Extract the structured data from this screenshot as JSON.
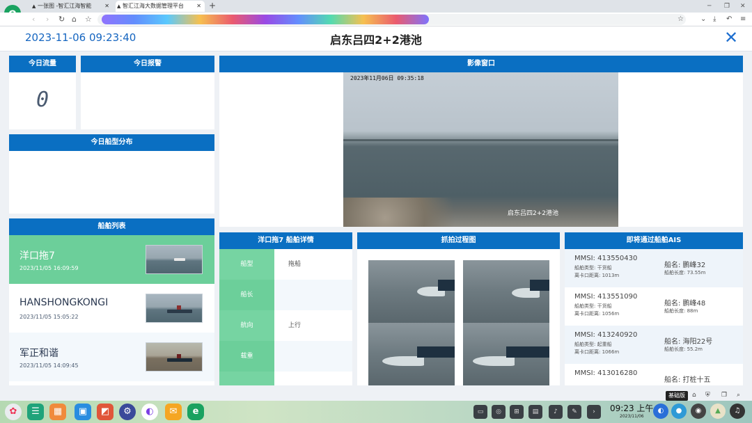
{
  "browser": {
    "tabs": [
      {
        "title": "一张图 -智汇江海智能"
      },
      {
        "title": "智汇江海大数据管理平台"
      }
    ],
    "logo_letter": "e"
  },
  "header": {
    "datetime": "2023-11-06 09:23:40",
    "title": "启东吕四2+2港池",
    "close_glyph": "✕"
  },
  "panels": {
    "today_flow": {
      "title": "今日流量",
      "value": "0"
    },
    "today_alarm": {
      "title": "今日报警"
    },
    "ship_type": {
      "title": "今日船型分布"
    },
    "ship_list": {
      "title": "船舶列表",
      "items": [
        {
          "name": "洋口拖7",
          "time": "2023/11/05 16:09:59"
        },
        {
          "name": "HANSHONGKONGI",
          "time": "2023/11/05 15:05:22"
        },
        {
          "name": "军正和谐",
          "time": "2023/11/05 14:09:45"
        }
      ]
    },
    "video": {
      "title": "影像窗口",
      "timestamp": "2023年11月06日  09:35:18",
      "caption": "启东吕四2+2港池"
    },
    "details": {
      "title": "洋口拖7 船舶详情",
      "rows": [
        {
          "label": "船型",
          "value": "拖船"
        },
        {
          "label": "船长",
          "value": ""
        },
        {
          "label": "航向",
          "value": "上行"
        },
        {
          "label": "载重",
          "value": ""
        }
      ]
    },
    "capture": {
      "title": "抓拍过程图"
    },
    "ais": {
      "title": "即将通过船舶AIS",
      "items": [
        {
          "mmsi": "MMSI:  413550430",
          "type": "船舶类型:  干货船",
          "dist": "离卡口距离:  1013m",
          "name": "船名:  鹏峰32",
          "length": "船舶长度:  73.55m"
        },
        {
          "mmsi": "MMSI:  413551090",
          "type": "船舶类型:  干货船",
          "dist": "离卡口距离:  1056m",
          "name": "船名:  鹏峰48",
          "length": "船舶长度:  88m"
        },
        {
          "mmsi": "MMSI:  413240920",
          "type": "船舶类型:  起重船",
          "dist": "离卡口距离:  1066m",
          "name": "船名:  海阳22号",
          "length": "船舶长度:  55.2m"
        },
        {
          "mmsi": "MMSI:  413016280",
          "type": "",
          "dist": "",
          "name": "船名:  打桩十五",
          "length": ""
        }
      ]
    }
  },
  "taskbar": {
    "clock_time": "09:23 上午",
    "clock_date": "2023/11/06",
    "tooltip": "基础版"
  },
  "colors": {
    "header_blue": "#0a6fc2",
    "active_green": "#6ccf9a",
    "datetime_blue": "#1565c0"
  }
}
